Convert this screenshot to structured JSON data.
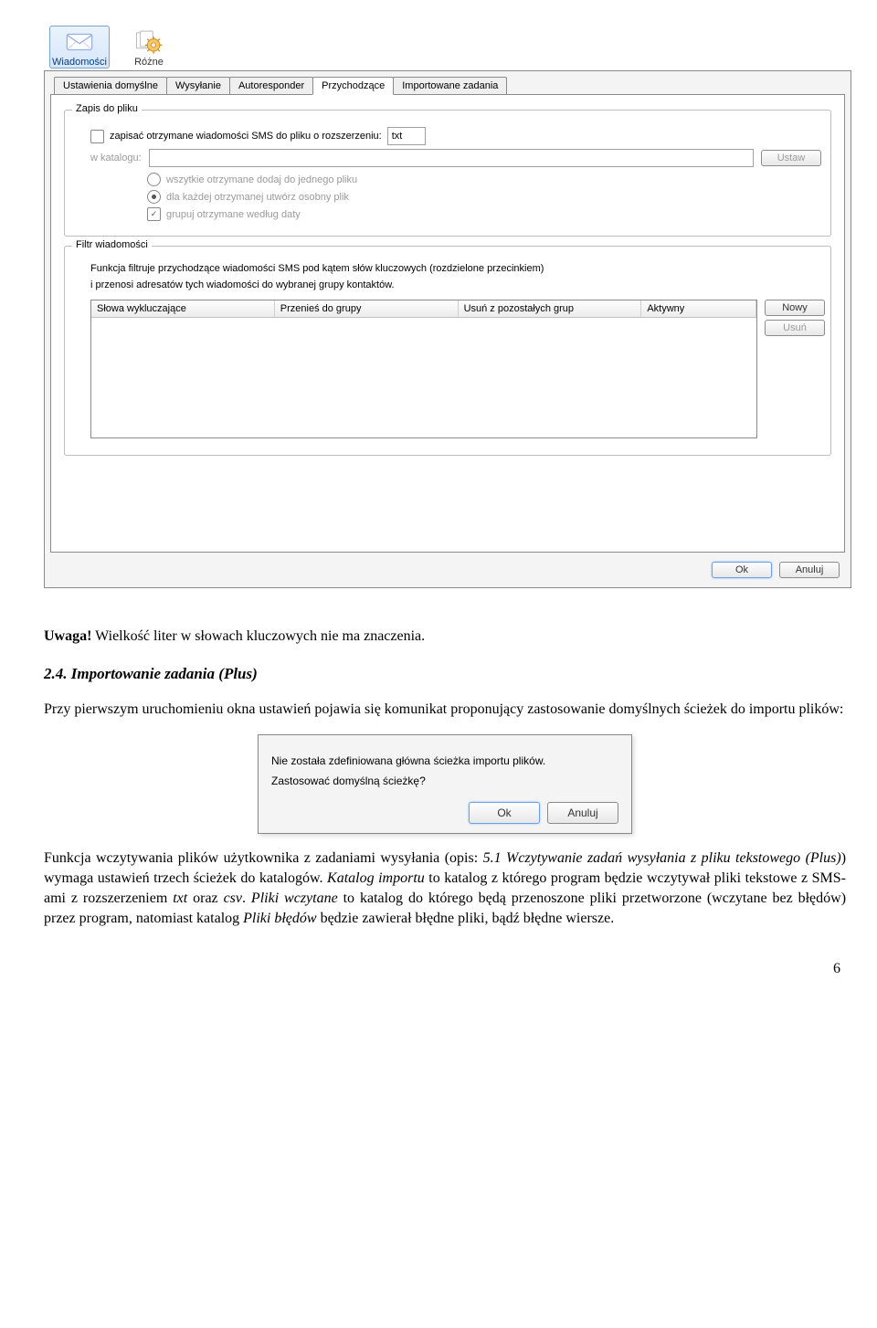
{
  "top": {
    "items": [
      {
        "label": "Wiadomości"
      },
      {
        "label": "Różne"
      }
    ]
  },
  "tabs": [
    "Ustawienia domyślne",
    "Wysyłanie",
    "Autoresponder",
    "Przychodzące",
    "Importowane zadania"
  ],
  "group_save": {
    "title": "Zapis do pliku",
    "save_checkbox_label": "zapisać otrzymane wiadomości SMS do pliku o rozszerzeniu:",
    "ext_value": "txt",
    "dir_label": "w katalogu:",
    "set_button": "Ustaw",
    "radio_all": "wszytkie otrzymane dodaj do jednego pliku",
    "radio_each": "dla każdej otrzymanej utwórz osobny plik",
    "group_checkbox": "grupuj otrzymane według daty"
  },
  "group_filter": {
    "title": "Filtr wiadomości",
    "desc1": "Funkcja filtruje przychodzące wiadomości SMS pod kątem słów kluczowych (rozdzielone przecinkiem)",
    "desc2": "i przenosi adresatów tych wiadomości do wybranej grupy kontaktów.",
    "columns": [
      "Słowa wykluczające",
      "Przenieś do grupy",
      "Usuń z pozostałych grup",
      "Aktywny"
    ],
    "new_button": "Nowy",
    "delete_button": "Usuń"
  },
  "bottom": {
    "ok": "Ok",
    "cancel": "Anuluj"
  },
  "doc": {
    "note_label": "Uwaga!",
    "note_text": "Wielkość liter w słowach kluczowych nie ma znaczenia.",
    "heading": "2.4. Importowanie zadania (Plus)",
    "para1": "Przy pierwszym uruchomieniu okna ustawień pojawia się komunikat proponujący zastosowanie domyślnych ścieżek do importu plików:",
    "dialog_line1": "Nie została zdefiniowana główna ścieżka importu plików.",
    "dialog_line2": "Zastosować domyślną ścieżkę?",
    "dialog_ok": "Ok",
    "dialog_cancel": "Anuluj",
    "para2_a": "Funkcja wczytywania plików użytkownika z zadaniami wysyłania (opis: ",
    "para2_b": "5.1 Wczytywanie zadań wysyłania z pliku tekstowego (Plus)",
    "para2_c": ") wymaga ustawień trzech ścieżek do katalogów. ",
    "para2_d": "Katalog importu",
    "para2_e": " to katalog z którego program będzie wczytywał pliki tekstowe z SMS-ami z rozszerzeniem ",
    "para2_f": "txt",
    "para2_g": " oraz ",
    "para2_h": "csv",
    "para2_i": ". ",
    "para2_j": "Pliki wczytane",
    "para2_k": " to katalog do którego będą przenoszone pliki przetworzone (wczytane bez błędów) przez program, natomiast katalog ",
    "para2_l": "Pliki błędów",
    "para2_m": " będzie zawierał błędne pliki, bądź błędne wiersze.",
    "page_number": "6"
  }
}
